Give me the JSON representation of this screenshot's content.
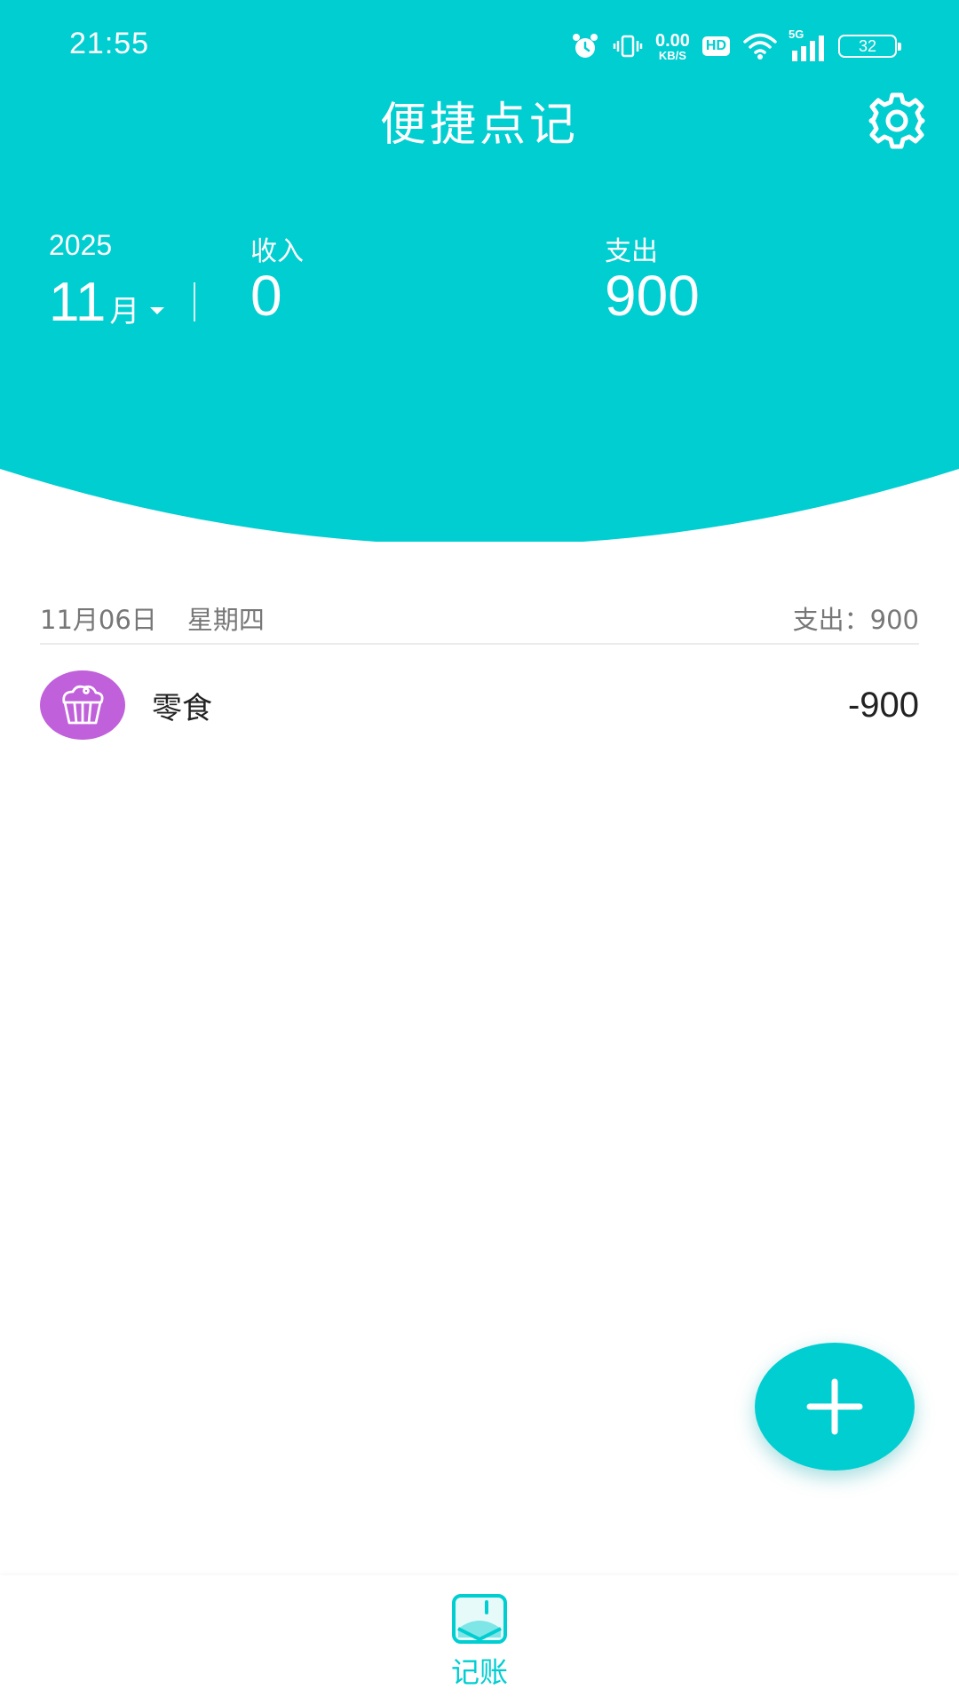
{
  "colors": {
    "primary": "#00CED1",
    "category_snacks": "#C060DA",
    "text_dark": "#222222",
    "text_muted": "#777777"
  },
  "status_bar": {
    "time": "21:55",
    "net_speed_value": "0.00",
    "net_speed_unit": "KB/S",
    "hd": "HD",
    "network": "5G",
    "battery": "32"
  },
  "header": {
    "title": "便捷点记",
    "year": "2025",
    "month": "11",
    "month_unit": "月",
    "income_label": "收入",
    "income_value": "0",
    "expense_label": "支出",
    "expense_value": "900",
    "settings_icon": "gear-icon"
  },
  "records": {
    "day": {
      "date": "11月06日",
      "weekday": "星期四",
      "summary": "支出：900"
    },
    "items": [
      {
        "category": "零食",
        "amount": "-900",
        "icon": "muffin-icon"
      }
    ]
  },
  "fab": {
    "icon": "plus-icon"
  },
  "bottom_nav": {
    "items": [
      {
        "label": "记账",
        "icon": "ledger-icon",
        "active": true
      }
    ]
  }
}
